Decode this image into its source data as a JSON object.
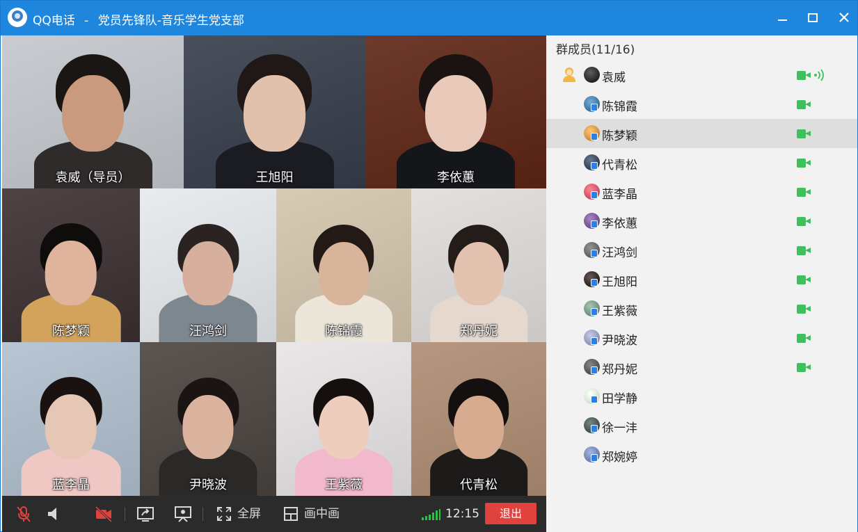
{
  "window": {
    "app_name": "QQ电话",
    "separator": "-",
    "group_name": "党员先锋队-音乐学生党支部",
    "controls": {
      "minimize": "—",
      "maximize": "☐",
      "close": "✕"
    }
  },
  "video_grid": {
    "tiles": [
      {
        "name": "袁威（导员）",
        "bg": "#c9cdd2",
        "skin": "#c99a7e",
        "hair": "#1a1614",
        "shirt": "#2e2b2a"
      },
      {
        "name": "王旭阳",
        "bg": "#4a4f5c",
        "skin": "#e2c1ac",
        "hair": "#1f1816",
        "shirt": "#1b1c22"
      },
      {
        "name": "李依蕙",
        "bg": "#6d3a2c",
        "skin": "#e9c9b9",
        "hair": "#1a1312",
        "shirt": "#15161a"
      },
      {
        "name": "陈梦颖",
        "bg": "#4e4345",
        "skin": "#e0b49c",
        "hair": "#0f0c0c",
        "shirt": "#d3a35b"
      },
      {
        "name": "汪鸿剑",
        "bg": "#e9ecef",
        "skin": "#d6b09c",
        "hair": "#2a2321",
        "shirt": "#7d8790"
      },
      {
        "name": "陈锦霞",
        "bg": "#d8cbb5",
        "skin": "#d8b49b",
        "hair": "#231915",
        "shirt": "#ece5da"
      },
      {
        "name": "郑丹妮",
        "bg": "#e3e1df",
        "skin": "#e4c2b0",
        "hair": "#241c18",
        "shirt": "#e4d8cf"
      },
      {
        "name": "蓝李晶",
        "bg": "#b8c6d4",
        "skin": "#e6c7b5",
        "hair": "#1a1210",
        "shirt": "#efc8c4"
      },
      {
        "name": "尹晓波",
        "bg": "#5c5652",
        "skin": "#d9b39d",
        "hair": "#1a1412",
        "shirt": "#2b2927"
      },
      {
        "name": "王紫薇",
        "bg": "#e9e7e8",
        "skin": "#efcdbd",
        "hair": "#15100e",
        "shirt": "#f1b9cb"
      },
      {
        "name": "代青松",
        "bg": "#b69780",
        "skin": "#d6ab8f",
        "hair": "#141010",
        "shirt": "#1d1b1a"
      }
    ]
  },
  "toolbar": {
    "mic_icon": "mic-muted-icon",
    "speaker_icon": "speaker-icon",
    "camera_icon": "camera-off-icon",
    "share_icon": "screen-share-icon",
    "present_icon": "presentation-icon",
    "fullscreen_label": "全屏",
    "pip_label": "画中画",
    "time": "12:15",
    "exit_label": "退出"
  },
  "members_panel": {
    "title": "群成员(11/16)",
    "members": [
      {
        "name": "袁威",
        "host": true,
        "video": true,
        "speaking": true,
        "avatar_color": "#222222"
      },
      {
        "name": "陈锦霞",
        "video": true,
        "avatar_color": "#3a6e9a"
      },
      {
        "name": "陈梦颖",
        "video": true,
        "selected": true,
        "avatar_color": "#c98a3a"
      },
      {
        "name": "代青松",
        "video": true,
        "avatar_color": "#2c3d52"
      },
      {
        "name": "蓝李晶",
        "video": true,
        "avatar_color": "#c94a5a"
      },
      {
        "name": "李依蕙",
        "video": true,
        "avatar_color": "#6b4a8a"
      },
      {
        "name": "汪鸿剑",
        "video": true,
        "avatar_color": "#5a5a5a"
      },
      {
        "name": "王旭阳",
        "video": true,
        "avatar_color": "#2a1e1a"
      },
      {
        "name": "王紫薇",
        "video": true,
        "avatar_color": "#6c8a7a"
      },
      {
        "name": "尹晓波",
        "video": true,
        "avatar_color": "#8a8fb0"
      },
      {
        "name": "郑丹妮",
        "video": true,
        "avatar_color": "#4a4a4a"
      },
      {
        "name": "田学静",
        "video": false,
        "avatar_color": "#cfe0c8"
      },
      {
        "name": "徐一沣",
        "video": false,
        "avatar_color": "#3d4a4a"
      },
      {
        "name": "郑婉婷",
        "video": false,
        "avatar_color": "#6a7aa8"
      }
    ]
  }
}
